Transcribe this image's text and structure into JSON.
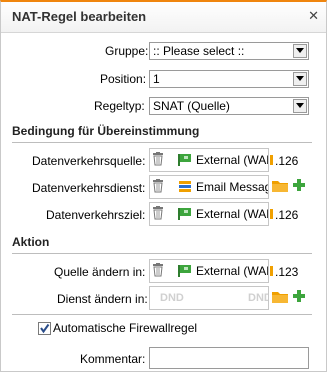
{
  "dialog": {
    "title": "NAT-Regel bearbeiten"
  },
  "fields": {
    "gruppe": {
      "label": "Gruppe:",
      "value": ":: Please select ::"
    },
    "position": {
      "label": "Position:",
      "value": "1"
    },
    "regeltyp": {
      "label": "Regeltyp:",
      "value": "SNAT (Quelle)"
    }
  },
  "sections": {
    "bedingung": "Bedingung für Übereinstimmung",
    "aktion": "Aktion"
  },
  "bedingung": {
    "quelle": {
      "label": "Datenverkehrsquelle:",
      "object": "External (WAN",
      "suffix": ".126"
    },
    "dienst": {
      "label": "Datenverkehrsdienst:",
      "object": "Email Messag"
    },
    "ziel": {
      "label": "Datenverkehrsziel:",
      "object": "External (WAN",
      "suffix": ".126"
    }
  },
  "aktion": {
    "quelle": {
      "label": "Quelle ändern in:",
      "object": "External (WAN",
      "suffix": ".123"
    },
    "dienst": {
      "label": "Dienst ändern in:",
      "placeholder_left": "DND",
      "placeholder_right": "DND"
    }
  },
  "firewall": {
    "label": "Automatische Firewallregel",
    "checked": true
  },
  "kommentar": {
    "label": "Kommentar:",
    "value": ""
  },
  "icons": [
    "close-icon",
    "dropdown-arrow-icon",
    "trash-icon",
    "network-icon",
    "service-icon",
    "folder-icon",
    "plus-icon",
    "checkmark-icon"
  ],
  "colors": {
    "accent": "#f0860f",
    "green": "#3da53d",
    "folder": "#f0a000"
  }
}
